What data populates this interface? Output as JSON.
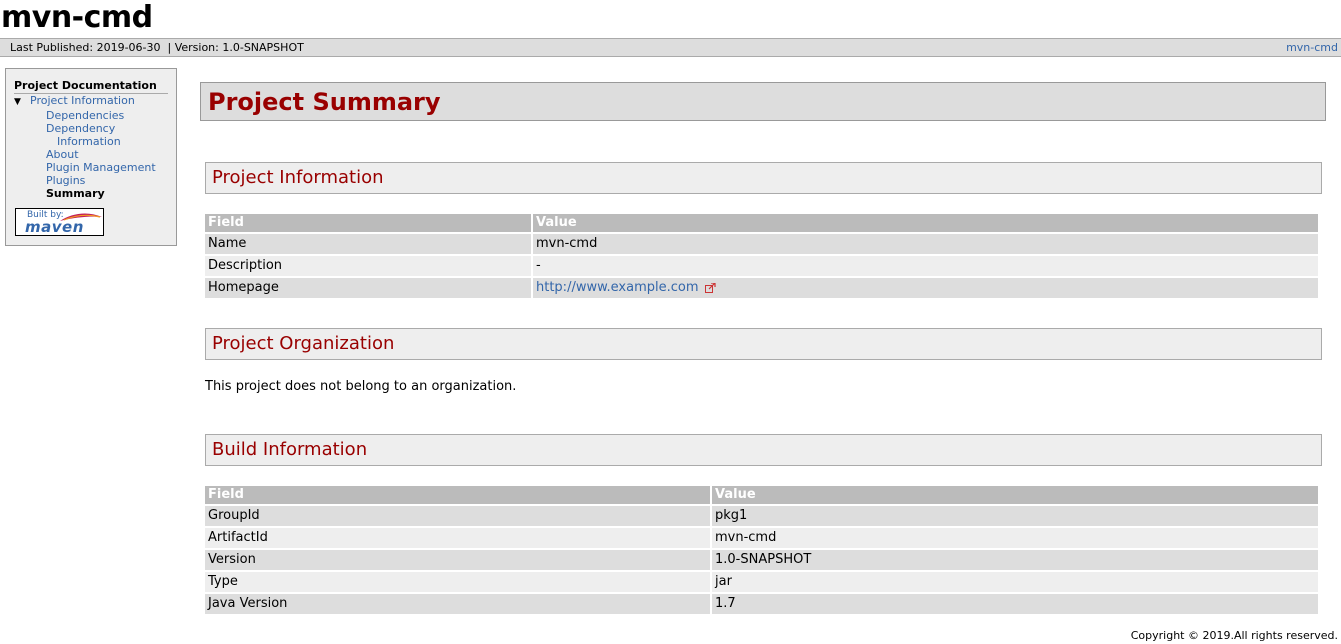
{
  "banner": {
    "title": "mvn-cmd"
  },
  "breadcrumbs": {
    "published": "Last Published: 2019-06-30",
    "version": "| Version: 1.0-SNAPSHOT",
    "right_link": "mvn-cmd"
  },
  "nav": {
    "heading": "Project Documentation",
    "section": "Project Information",
    "items": [
      "Dependencies",
      "Dependency",
      "Information",
      "About",
      "Plugin Management",
      "Plugins"
    ],
    "current": "Summary",
    "built_by": "Built by:",
    "maven": "maven"
  },
  "page": {
    "title": "Project Summary",
    "project_info": {
      "heading": "Project Information",
      "columns": [
        "Field",
        "Value"
      ],
      "rows": [
        [
          "Name",
          "mvn-cmd"
        ],
        [
          "Description",
          "-"
        ],
        [
          "Homepage",
          "http://www.example.com"
        ]
      ]
    },
    "organization": {
      "heading": "Project Organization",
      "text": "This project does not belong to an organization."
    },
    "build_info": {
      "heading": "Build Information",
      "columns": [
        "Field",
        "Value"
      ],
      "rows": [
        [
          "GroupId",
          "pkg1"
        ],
        [
          "ArtifactId",
          "mvn-cmd"
        ],
        [
          "Version",
          "1.0-SNAPSHOT"
        ],
        [
          "Type",
          "jar"
        ],
        [
          "Java Version",
          "1.7"
        ]
      ]
    }
  },
  "footer": {
    "copyright": "Copyright © 2019.All rights reserved."
  },
  "colors": {
    "heading_red": "#990000",
    "link_blue": "#3366aa",
    "header_gray": "#bbbbbb"
  }
}
